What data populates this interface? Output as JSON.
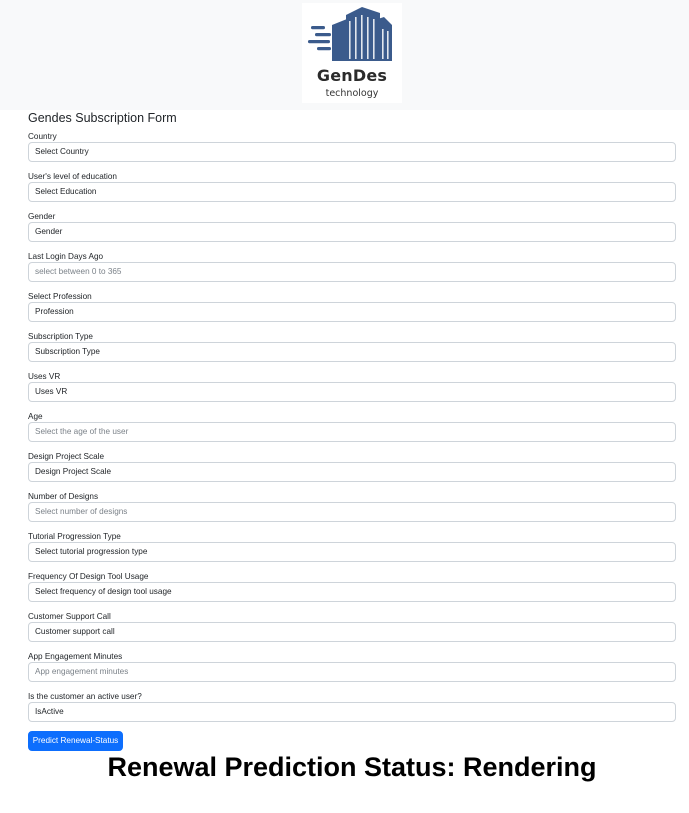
{
  "logo": {
    "name": "GenDes",
    "subtitle": "technology",
    "colors": {
      "bars": "#3b5b8c",
      "text": "#2b2b2b"
    }
  },
  "form": {
    "title": "Gendes Subscription Form",
    "fields": [
      {
        "label": "Country",
        "value": "Select Country",
        "kind": "select"
      },
      {
        "label": "User's level of education",
        "value": "Select Education",
        "kind": "select"
      },
      {
        "label": "Gender",
        "value": "Gender",
        "kind": "select"
      },
      {
        "label": "Last Login Days Ago",
        "value": "",
        "placeholder": "select between 0 to 365",
        "kind": "input"
      },
      {
        "label": "Select Profession",
        "value": "Profession",
        "kind": "select"
      },
      {
        "label": "Subscription Type",
        "value": "Subscription Type",
        "kind": "select"
      },
      {
        "label": "Uses VR",
        "value": "Uses VR",
        "kind": "select"
      },
      {
        "label": "Age",
        "value": "",
        "placeholder": "Select the age of the user",
        "kind": "input"
      },
      {
        "label": "Design Project Scale",
        "value": "Design Project Scale",
        "kind": "select"
      },
      {
        "label": "Number of Designs",
        "value": "",
        "placeholder": "Select number of designs",
        "kind": "input"
      },
      {
        "label": "Tutorial Progression Type",
        "value": "Select tutorial progression type",
        "kind": "select"
      },
      {
        "label": "Frequency Of Design Tool Usage",
        "value": "Select frequency of design tool usage",
        "kind": "select"
      },
      {
        "label": "Customer Support Call",
        "value": "Customer support call",
        "kind": "select"
      },
      {
        "label": "App Engagement Minutes",
        "value": "",
        "placeholder": "App engagement minutes",
        "kind": "input"
      },
      {
        "label": "Is the customer an active user?",
        "value": "IsActive",
        "kind": "select"
      }
    ],
    "submit_label": "Predict Renewal-Status",
    "colors": {
      "primary": "#0d6efd",
      "border": "#ced4da",
      "header_bg": "#f8f9fa"
    }
  },
  "result": {
    "heading": "Renewal Prediction Status: Rendering"
  }
}
